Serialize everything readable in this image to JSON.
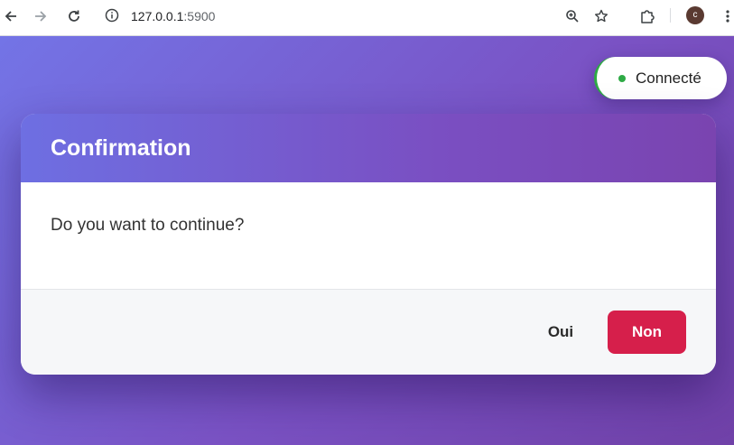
{
  "browser": {
    "url_host": "127.0.0.1",
    "url_port": ":5900",
    "profile_initial": "c",
    "icons": {
      "back": "arrow-left-icon",
      "forward": "arrow-right-icon",
      "reload": "reload-icon",
      "site_info": "info-icon",
      "zoom": "zoom-in-icon",
      "bookmark": "star-icon",
      "extensions": "puzzle-icon",
      "menu": "kebab-menu-icon"
    }
  },
  "status": {
    "label": "Connecté",
    "color": "#2eaa45"
  },
  "dialog": {
    "title": "Confirmation",
    "message": "Do you want to continue?",
    "yes_label": "Oui",
    "no_label": "Non",
    "no_color": "#d61f4b"
  },
  "theme": {
    "gradient_start": "#7374e6",
    "gradient_end": "#7041a8"
  }
}
